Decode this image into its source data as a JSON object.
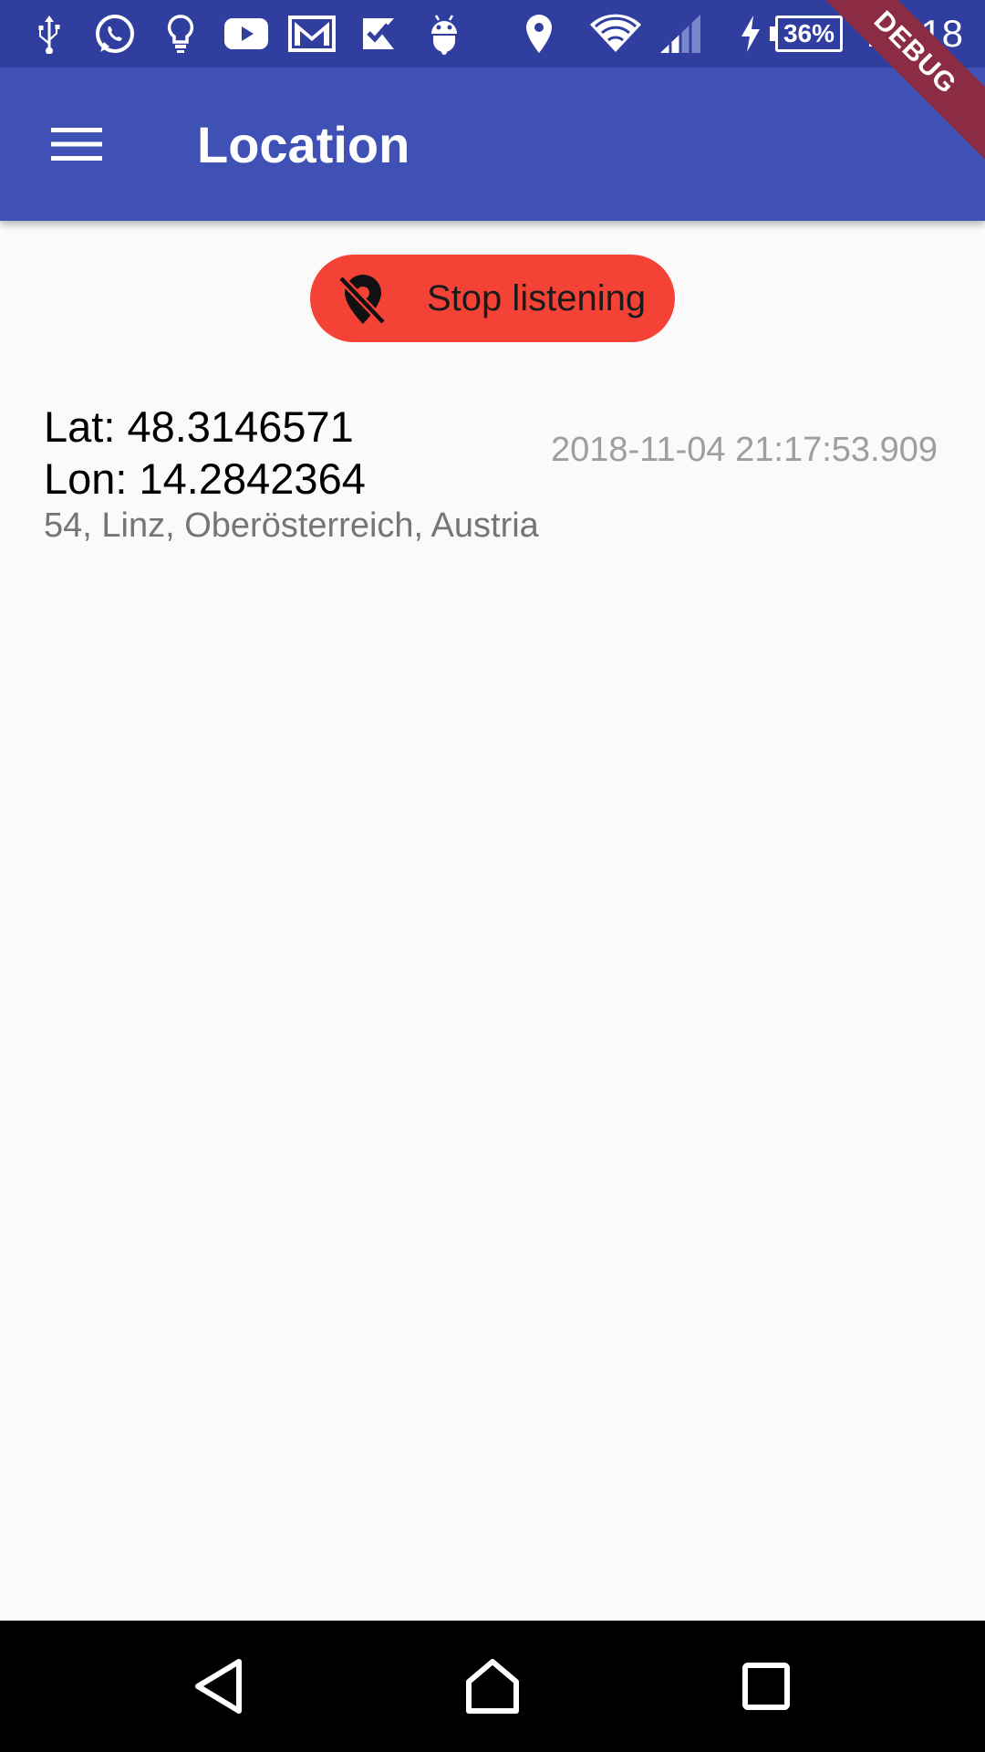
{
  "status_bar": {
    "battery_percent": "36%",
    "time": "21:18",
    "icons": [
      "usb-icon",
      "whatsapp-icon",
      "lightbulb-icon",
      "youtube-icon",
      "gmail-icon",
      "tasks-icon",
      "android-icon",
      "location-pin-icon",
      "wifi-icon",
      "signal-icon",
      "charging-icon",
      "battery-icon"
    ]
  },
  "app_bar": {
    "title": "Location",
    "menu_icon": "menu-icon",
    "background": "#3f51b5"
  },
  "debug_banner": {
    "label": "DEBUG"
  },
  "stop_button": {
    "label": "Stop listening",
    "icon": "location-off-icon",
    "color": "#f44336"
  },
  "location": {
    "lat": "Lat: 48.3146571",
    "lon": "Lon: 14.2842364",
    "address": "54, Linz, Oberösterreich, Austria",
    "timestamp": "2018-11-04 21:17:53.909"
  },
  "nav_bar": {
    "back": "back-icon",
    "home": "home-icon",
    "recents": "recents-icon"
  }
}
